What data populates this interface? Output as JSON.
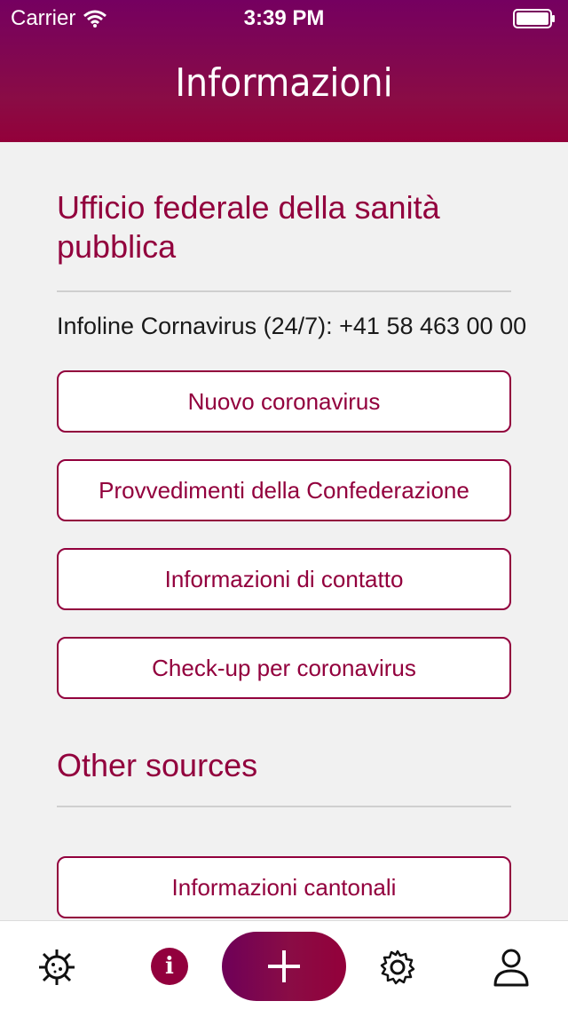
{
  "status_bar": {
    "carrier": "Carrier",
    "time": "3:39 PM"
  },
  "header": {
    "title": "Informazioni"
  },
  "section1": {
    "title_line1": "Ufficio federale della sanità",
    "title_line2": "pubblica",
    "infoline": "Infoline Cornavirus (24/7): +41 58 463 00 00",
    "buttons": [
      "Nuovo coronavirus",
      "Provvedimenti della Confederazione",
      "Informazioni di contatto",
      "Check-up per coronavirus"
    ]
  },
  "section2": {
    "title": "Other sources",
    "buttons": [
      "Informazioni cantonali"
    ]
  },
  "tabbar": {
    "tabs": [
      "virus-icon",
      "info-icon",
      "add-icon",
      "settings-icon",
      "profile-icon"
    ],
    "info_glyph": "i",
    "accent": "#92003d"
  }
}
